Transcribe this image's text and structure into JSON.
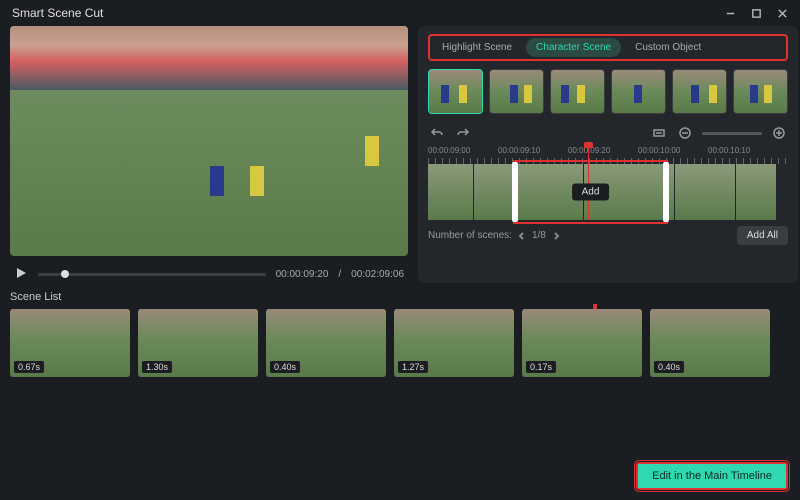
{
  "title": "Smart Scene Cut",
  "preview": {
    "current_time": "00:00:09:20",
    "total_time": "00:02:09:06"
  },
  "tabs": {
    "items": [
      {
        "label": "Highlight Scene"
      },
      {
        "label": "Character Scene"
      },
      {
        "label": "Custom Object"
      }
    ]
  },
  "ruler": {
    "marks": [
      "00:00:09:00",
      "00:00:09:10",
      "00:00:09:20",
      "00:00:10:00",
      "00:00:10:10"
    ]
  },
  "add_label": "Add",
  "scenes_info": {
    "label": "Number of scenes:",
    "page": "1/8",
    "add_all": "Add All"
  },
  "scene_list": {
    "heading": "Scene List",
    "items": [
      {
        "duration": "0.67s"
      },
      {
        "duration": "1.30s"
      },
      {
        "duration": "0.40s"
      },
      {
        "duration": "1.27s"
      },
      {
        "duration": "0.17s"
      },
      {
        "duration": "0.40s"
      }
    ]
  },
  "edit_button": "Edit in the Main Timeline"
}
